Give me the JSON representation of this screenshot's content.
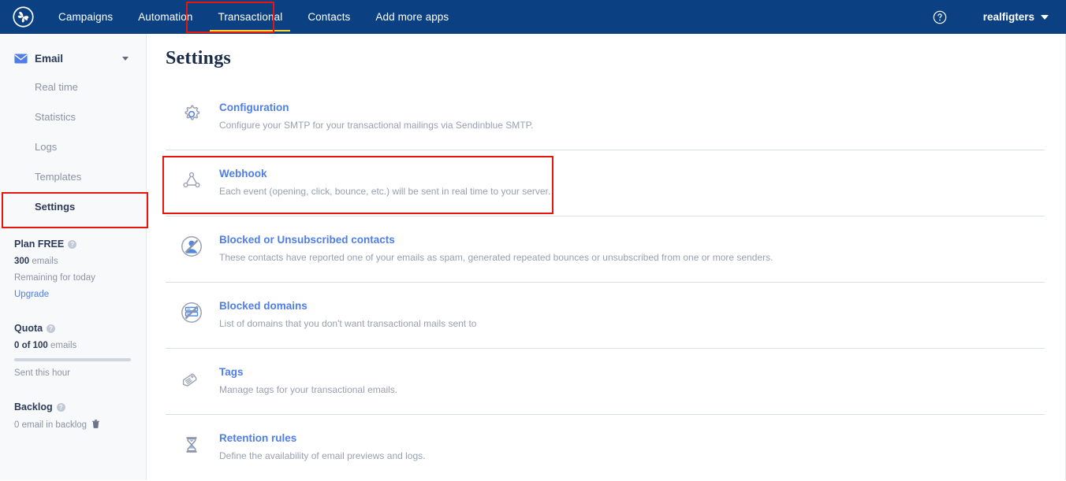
{
  "header": {
    "logo_icon": "sendinblue-pinwheel-logo",
    "tabs": [
      {
        "label": "Campaigns",
        "active": false
      },
      {
        "label": "Automation",
        "active": false
      },
      {
        "label": "Transactional",
        "active": true
      },
      {
        "label": "Contacts",
        "active": false
      },
      {
        "label": "Add more apps",
        "active": false
      }
    ],
    "help_icon": "help-circle-icon",
    "username": "realfigters",
    "user_caret_icon": "chevron-down-icon"
  },
  "sidebar": {
    "section": {
      "label": "Email",
      "icon": "envelope-icon",
      "caret_icon": "caret-down-icon"
    },
    "items": [
      {
        "label": "Real time",
        "current": false
      },
      {
        "label": "Statistics",
        "current": false
      },
      {
        "label": "Logs",
        "current": false
      },
      {
        "label": "Templates",
        "current": false
      },
      {
        "label": "Settings",
        "current": true
      }
    ],
    "plan": {
      "title": "Plan FREE",
      "help_icon": "help-circle-icon",
      "amount": "300",
      "amount_unit": " emails",
      "subtext": "Remaining for today",
      "upgrade_link": "Upgrade"
    },
    "quota": {
      "title": "Quota",
      "help_icon": "help-circle-icon",
      "used": "0 of 100",
      "used_unit": " emails",
      "progress_percent": 0,
      "subtext": "Sent this hour"
    },
    "backlog": {
      "title": "Backlog",
      "help_icon": "help-circle-icon",
      "value": "0 email in backlog",
      "delete_icon": "trash-icon"
    }
  },
  "main": {
    "title": "Settings",
    "rows": [
      {
        "icon": "gear-icon",
        "title": "Configuration",
        "description": "Configure your SMTP for your transactional mailings via Sendinblue SMTP."
      },
      {
        "icon": "webhook-network-icon",
        "title": "Webhook",
        "description": "Each event (opening, click, bounce, etc.) will be sent in real time to your server."
      },
      {
        "icon": "blocked-contact-icon",
        "title": "Blocked or Unsubscribed contacts",
        "description": "These contacts have reported one of your emails as spam, generated repeated bounces or unsubscribed from one or more senders."
      },
      {
        "icon": "blocked-domain-icon",
        "title": "Blocked domains",
        "description": "List of domains that you don't want transactional mails sent to"
      },
      {
        "icon": "tag-icon",
        "title": "Tags",
        "description": "Manage tags for your transactional emails."
      },
      {
        "icon": "hourglass-icon",
        "title": "Retention rules",
        "description": "Define the availability of email previews and logs."
      }
    ]
  },
  "highlights": {
    "colors": {
      "annotation": "#e8150c",
      "nav_background": "#0b4182",
      "active_tab_underline": "#fdd835",
      "link_blue": "#4f7ee8",
      "muted_text": "#98a0b0",
      "dark_text": "#2b3a58"
    }
  }
}
